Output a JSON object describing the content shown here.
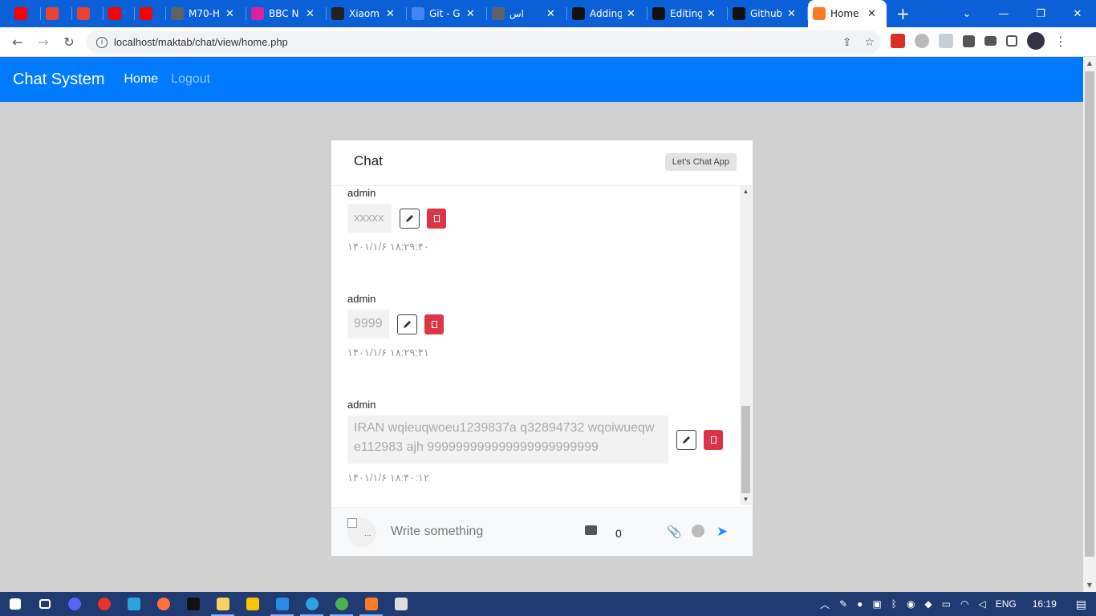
{
  "browser": {
    "tabs": [
      {
        "title": "",
        "icon": "youtube-icon",
        "color": "#ff0000"
      },
      {
        "title": "",
        "icon": "gmail-icon",
        "color": "#ea4335"
      },
      {
        "title": "",
        "icon": "gmail-icon",
        "color": "#ea4335"
      },
      {
        "title": "",
        "icon": "youtube-icon",
        "color": "#ff0000"
      },
      {
        "title": "",
        "icon": "youtube-icon",
        "color": "#ff0000"
      },
      {
        "title": "M70-H",
        "icon": "globe-icon",
        "color": "#5f6368"
      },
      {
        "title": "BBC N",
        "icon": "instagram-icon",
        "color": "#d6249f"
      },
      {
        "title": "Xiaom",
        "icon": "xiaomi-icon",
        "color": "#222222"
      },
      {
        "title": "Git - G",
        "icon": "docs-icon",
        "color": "#4285f4"
      },
      {
        "title": "اس",
        "icon": "translate-icon",
        "color": "#5f6368"
      },
      {
        "title": "Adding",
        "icon": "github-icon",
        "color": "#111111"
      },
      {
        "title": "Editing",
        "icon": "github-icon",
        "color": "#111111"
      },
      {
        "title": "Github",
        "icon": "github-icon",
        "color": "#111111"
      },
      {
        "title": "Home",
        "icon": "xampp-icon",
        "color": "#fb7a24",
        "active": true
      }
    ],
    "url": "localhost/maktab/chat/view/home.php"
  },
  "navbar": {
    "brand": "Chat System",
    "links": [
      "Home",
      "Logout"
    ],
    "color": "#007bff"
  },
  "chat": {
    "title": "Chat",
    "badge": "Let's Chat App",
    "messages": [
      {
        "user": "admin",
        "text": "xxxxx",
        "time": "۱۴۰۱/۱/۶ ۱۸:۲۹:۴۰"
      },
      {
        "user": "admin",
        "text": "9999",
        "time": "۱۴۰۱/۱/۶ ۱۸:۲۹:۴۱"
      },
      {
        "user": "admin",
        "text": "IRAN wqieuqwoeu1239837a q32894732 wqoiwueqw e112983 ajh 999999999999999999999999",
        "time": "۱۴۰۱/۱/۶ ۱۸:۴۰:۱۲"
      }
    ],
    "composer": {
      "placeholder": "Write something",
      "count": "0",
      "avatar_alt": "..."
    },
    "delete_color": "#dc3545"
  },
  "taskbar": {
    "lang": "ENG",
    "time": "16:19"
  }
}
